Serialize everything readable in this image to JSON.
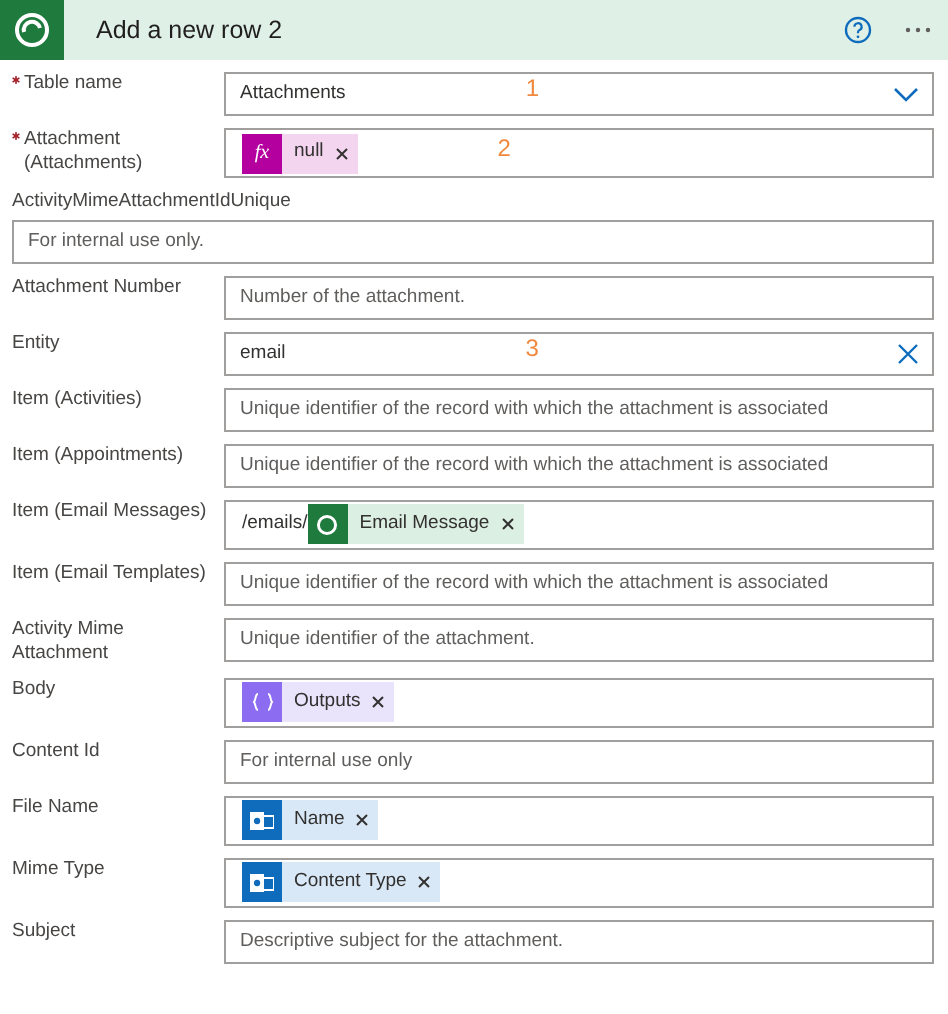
{
  "header": {
    "title": "Add a new row 2"
  },
  "fields": [
    {
      "label": "Table name",
      "required": true,
      "kind": "select",
      "value": "Attachments",
      "annotation": "1"
    },
    {
      "label": "Attachment (Attachments)",
      "required": true,
      "kind": "tokens",
      "tokens": [
        {
          "kind": "expression",
          "badge": "fx",
          "text": "null"
        }
      ],
      "annotation": "2"
    },
    {
      "label": "ActivityMimeAttachmentIdUnique",
      "required": false,
      "kind": "wide_input",
      "placeholder": "For internal use only."
    },
    {
      "label": "Attachment Number",
      "required": false,
      "kind": "input",
      "placeholder": "Number of the attachment."
    },
    {
      "label": "Entity",
      "required": false,
      "kind": "clearable",
      "value": "email",
      "annotation": "3"
    },
    {
      "label": "Item (Activities)",
      "required": false,
      "kind": "input",
      "placeholder": "Unique identifier of the record with which the attachment is associated"
    },
    {
      "label": "Item (Appointments)",
      "required": false,
      "kind": "input",
      "placeholder": "Unique identifier of the record with which the attachment is associated"
    },
    {
      "label": "Item (Email Messages)",
      "required": false,
      "kind": "tokens",
      "prefix": "/emails/",
      "tokens": [
        {
          "kind": "record",
          "text": "Email Message"
        }
      ]
    },
    {
      "label": "Item (Email Templates)",
      "required": false,
      "kind": "input",
      "placeholder": "Unique identifier of the record with which the attachment is associated"
    },
    {
      "label": "Activity Mime Attachment",
      "required": false,
      "kind": "input",
      "placeholder": "Unique identifier of the attachment."
    },
    {
      "label": "Body",
      "required": false,
      "kind": "tokens",
      "tokens": [
        {
          "kind": "variable",
          "text": "Outputs"
        }
      ]
    },
    {
      "label": "Content Id",
      "required": false,
      "kind": "input",
      "placeholder": "For internal use only"
    },
    {
      "label": "File Name",
      "required": false,
      "kind": "tokens",
      "tokens": [
        {
          "kind": "mail",
          "text": "Name"
        }
      ]
    },
    {
      "label": "Mime Type",
      "required": false,
      "kind": "tokens",
      "tokens": [
        {
          "kind": "mail",
          "text": "Content Type"
        }
      ]
    },
    {
      "label": "Subject",
      "required": false,
      "kind": "input",
      "placeholder": "Descriptive subject for the attachment."
    }
  ]
}
